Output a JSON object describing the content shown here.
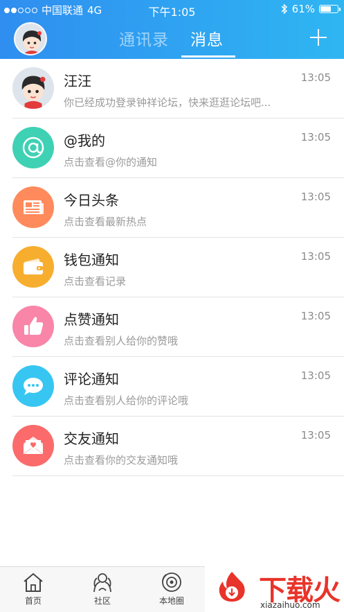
{
  "status_bar": {
    "carrier": "中国联通",
    "network": "4G",
    "time": "下午1:05",
    "battery": "61%",
    "battery_level": 0.61
  },
  "header": {
    "tabs": [
      {
        "label": "通讯录",
        "active": false
      },
      {
        "label": "消息",
        "active": true
      }
    ],
    "add_icon": "plus-icon"
  },
  "messages": [
    {
      "title": "汪汪",
      "subtitle": "你已经成功登录钟祥论坛，快来逛逛论坛吧...",
      "time": "13:05",
      "icon": "user-avatar",
      "color": "#dfe6ee"
    },
    {
      "title": "@我的",
      "subtitle": "点击查看@你的通知",
      "time": "13:05",
      "icon": "at-icon",
      "color": "#3fd1b4"
    },
    {
      "title": "今日头条",
      "subtitle": "点击查看最新热点",
      "time": "13:05",
      "icon": "newspaper-icon",
      "color": "#ff8a5c"
    },
    {
      "title": "钱包通知",
      "subtitle": "点击查看记录",
      "time": "13:05",
      "icon": "wallet-icon",
      "color": "#f7ae2f"
    },
    {
      "title": "点赞通知",
      "subtitle": "点击查看别人给你的赞哦",
      "time": "13:05",
      "icon": "thumbs-up-icon",
      "color": "#f985a9"
    },
    {
      "title": "评论通知",
      "subtitle": "点击查看别人给你的评论哦",
      "time": "13:05",
      "icon": "chat-bubble-icon",
      "color": "#37c6f2"
    },
    {
      "title": "交友通知",
      "subtitle": "点击查看你的交友通知哦",
      "time": "13:05",
      "icon": "envelope-heart-icon",
      "color": "#fb6b6b"
    }
  ],
  "tab_bar": [
    {
      "label": "首页",
      "icon": "home-icon"
    },
    {
      "label": "社区",
      "icon": "community-icon"
    },
    {
      "label": "本地圈",
      "icon": "local-circle-icon"
    }
  ],
  "watermark": {
    "text": "下载火",
    "url": "xiazaihuo.com",
    "color": "#e8342a"
  }
}
